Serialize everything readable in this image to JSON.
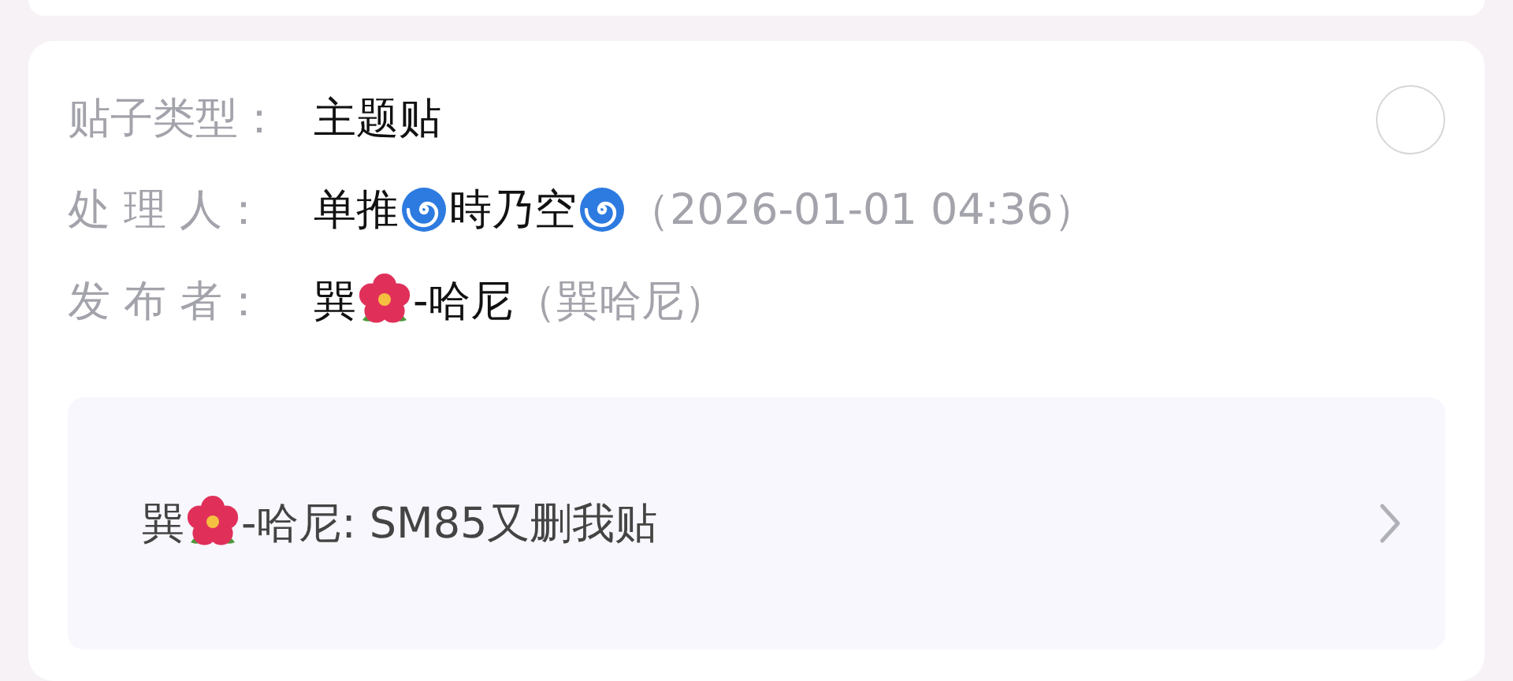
{
  "post_info": {
    "selected": false,
    "rows": [
      {
        "label": "贴子类型：",
        "parts": [
          {
            "kind": "text",
            "text": "主题贴"
          }
        ]
      },
      {
        "label": "处 理 人：",
        "parts": [
          {
            "kind": "text",
            "text": "单推"
          },
          {
            "kind": "swirl"
          },
          {
            "kind": "text",
            "text": "時乃空"
          },
          {
            "kind": "swirl"
          }
        ],
        "note": "（2026-01-01 04:36）"
      },
      {
        "label": "发 布 者：",
        "parts": [
          {
            "kind": "text",
            "text": "巽"
          },
          {
            "kind": "flower"
          },
          {
            "kind": "text",
            "text": "-哈尼"
          }
        ],
        "note": "（巽哈尼）"
      }
    ]
  },
  "linked_post": {
    "parts": [
      {
        "kind": "text",
        "text": "巽"
      },
      {
        "kind": "flower"
      },
      {
        "kind": "text",
        "text": "-哈尼: SM85又删我贴"
      }
    ]
  }
}
